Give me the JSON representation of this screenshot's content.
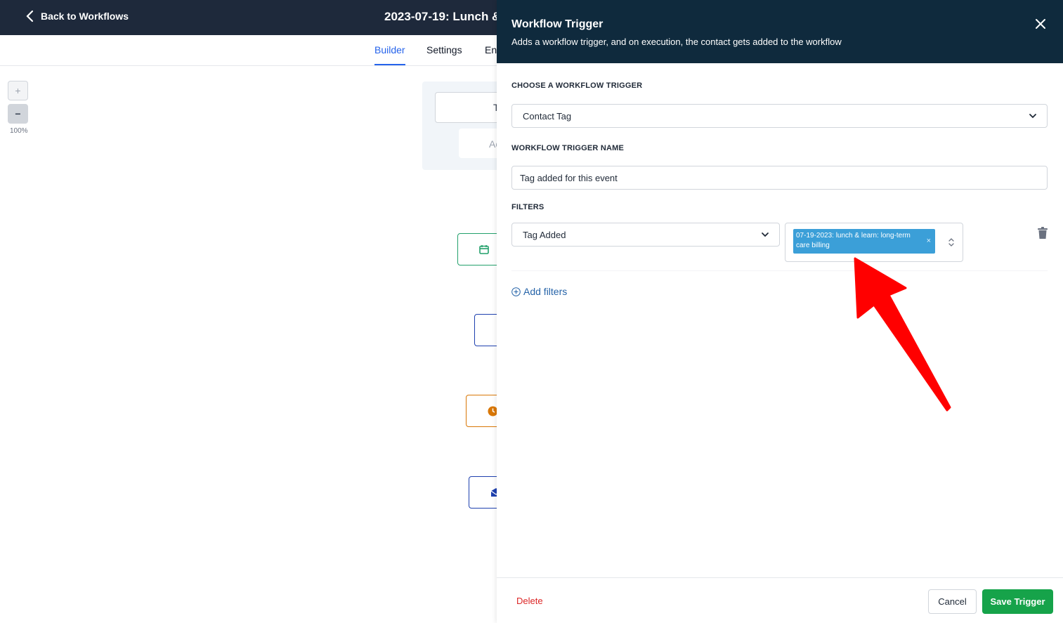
{
  "header": {
    "back_label": "Back to Workflows",
    "workflow_title": "2023-07-19: Lunch &"
  },
  "tabs": [
    {
      "label": "Builder",
      "active": true
    },
    {
      "label": "Settings",
      "active": false
    },
    {
      "label": "En",
      "active": false
    }
  ],
  "canvas": {
    "zoom_in_label": "+",
    "zoom_out_label": "−",
    "zoom_level": "100%",
    "trigger_partial_text": "T",
    "trigger_partial_text2": "Ac"
  },
  "panel": {
    "title": "Workflow Trigger",
    "subtitle": "Adds a workflow trigger, and on execution, the contact gets added to the workflow",
    "choose_label": "CHOOSE A WORKFLOW TRIGGER",
    "trigger_type": "Contact Tag",
    "name_label": "WORKFLOW TRIGGER NAME",
    "name_value": "Tag added for this event",
    "filters_label": "FILTERS",
    "filter_condition": "Tag Added",
    "filter_tag": "07-19-2023: lunch & learn: long-term care billing",
    "tag_remove": "×",
    "add_filters_label": "Add filters"
  },
  "footer": {
    "delete_label": "Delete",
    "cancel_label": "Cancel",
    "save_label": "Save Trigger"
  },
  "colors": {
    "topbar": "#1e293b",
    "panel_header": "#0f2a3d",
    "accent": "#2563eb",
    "tag_chip": "#3b9fd8",
    "save": "#16a34a",
    "delete": "#dc2626",
    "annotation_arrow": "#ff0000"
  }
}
